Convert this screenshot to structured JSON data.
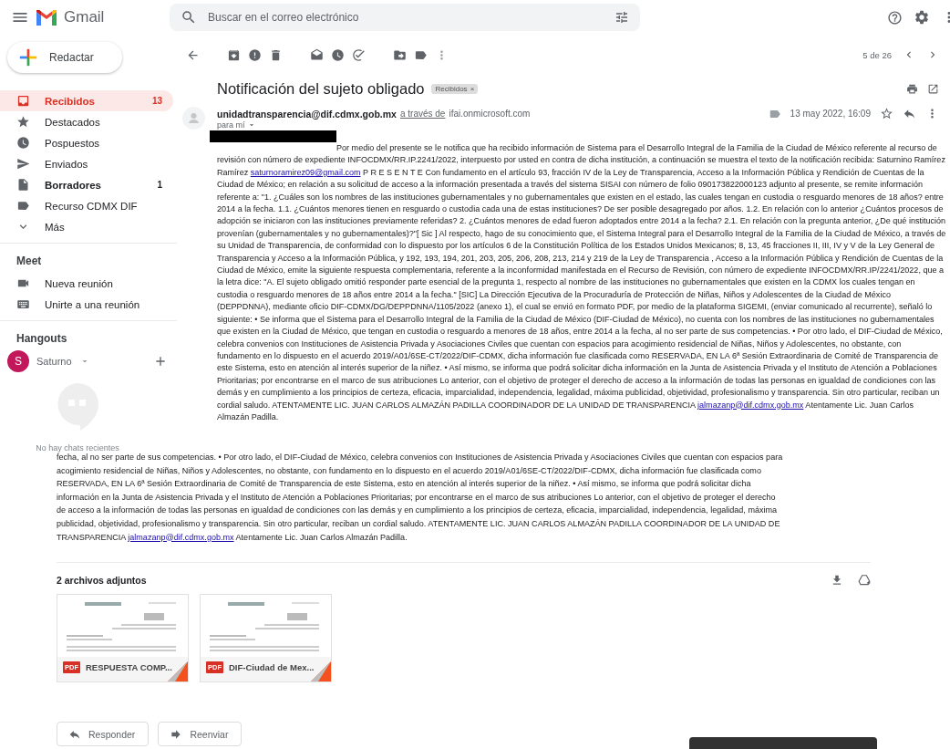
{
  "header": {
    "app_name": "Gmail",
    "search": {
      "placeholder": "Buscar en el correo electrónico"
    }
  },
  "compose": {
    "label": "Redactar"
  },
  "sidebar": {
    "items": [
      {
        "label": "Recibidos",
        "kind": "inbox",
        "count": "13",
        "selected": true,
        "unread": true
      },
      {
        "label": "Destacados",
        "kind": "star",
        "selected": false,
        "unread": false
      },
      {
        "label": "Pospuestos",
        "kind": "clock",
        "selected": false,
        "unread": false
      },
      {
        "label": "Enviados",
        "kind": "send",
        "selected": false,
        "unread": false
      },
      {
        "label": "Borradores",
        "kind": "draft",
        "count": "1",
        "selected": false,
        "unread": true
      },
      {
        "label": "Recurso CDMX DIF",
        "kind": "label",
        "selected": false,
        "unread": false
      },
      {
        "label": "Más",
        "kind": "more",
        "selected": false,
        "unread": false
      }
    ]
  },
  "meet": {
    "title": "Meet",
    "items": [
      {
        "label": "Nueva reunión",
        "kind": "video"
      },
      {
        "label": "Unirte a una reunión",
        "kind": "keyboard"
      }
    ]
  },
  "hangouts": {
    "title": "Hangouts",
    "user": {
      "initial": "S",
      "name": "Saturno"
    },
    "empty_text": "No hay chats recientes"
  },
  "toolbar": {
    "pagination": "5 de 26"
  },
  "message": {
    "subject": "Notificación del sujeto obligado",
    "labels": [
      {
        "text": "Recibidos",
        "remove": "×"
      }
    ],
    "sender": {
      "email": "unidadtransparencia@dif.cdmx.gob.mx",
      "via": "a través de",
      "via_domain": "ifai.onmicrosoft.com"
    },
    "recipient": "para mí",
    "date": "13 may 2022, 16:09",
    "starred": false,
    "body": [
      {
        "kind": "text",
        "text": "Por medio del presente se le notifica que ha recibido información de Sistema para el Desarrollo Integral de la Familia de la Ciudad de México referente al recurso de revisión con número de expediente INFOCDMX/RR.IP.2241/2022, interpuesto por usted en contra de dicha institución, a continuación se muestra el texto de la notificación recibida: Saturnino Ramírez Ramírez "
      },
      {
        "kind": "link",
        "text": "saturnoramirez09@gmail.com"
      },
      {
        "kind": "text",
        "text": " P R E S E N T E Con fundamento en el artículo 93, fracción IV de la Ley de Transparencia, Acceso a la Información Pública y Rendición de Cuentas de la Ciudad de México; en relación a su solicitud de acceso a la información presentada a través del sistema SISAI con número de folio 090173822000123 adjunto al presente, se remite información referente a: \"1. ¿Cuáles son los nombres de las instituciones gubernamentales y no gubernamentales que existen en el estado, las cuales tengan en custodia o resguardo menores de 18 años? entre 2014 a la fecha. 1.1. ¿Cuántos menores tienen en resguardo o custodia cada una de estas instituciones? De ser posible desagregado por años. 1.2. En relación con lo anterior ¿Cuántos procesos de adopción se iniciaron con las instituciones previamente referidas? 2. ¿Cuántos menores de edad fueron adoptados entre 2014 a la fecha? 2.1. En relación con la pregunta anterior, ¿De qué institución provenían (gubernamentales y no gubernamentales)?\"[ Sic ] Al respecto, hago de su conocimiento que, el Sistema Integral para el Desarrollo Integral de la Familia de la Ciudad de México, a través de su Unidad de Transparencia, de conformidad con lo dispuesto por los artículos 6 de la Constitución Política de los Estados Unidos Mexicanos; 8, 13, 45 fracciones II, III, IV y V de la Ley General de Transparencia y Acceso a la Información Pública, y 192, 193, 194, 201, 203, 205, 206, 208, 213, 214 y 219 de la Ley de Transparencia , Acceso a la Información Pública y Rendición de Cuentas de la Ciudad de México, emite la siguiente respuesta complementaria, referente a la inconformidad manifestada en el Recurso de Revisión, con número de expediente INFOCDMX/RR.IP/2241/2022, que a la letra dice: \"A. El sujeto obligado omitió responder parte esencial de la pregunta 1, respecto al nombre de las instituciones no gubernamentales que existen en la CDMX los cuales tengan en custodia o resguardo menores de 18 años entre 2014 a la fecha.\" [SIC] La Dirección Ejecutiva de la Procuraduría de Protección de Niñas, Niños y Adolescentes de la Ciudad de México (DEPPDNNA), mediante oficio DIF-CDMX/DG/DEPPDNNA/1105/2022 (anexo 1), el cual se envió en formato PDF, por medio de la plataforma SIGEMI, (enviar comunicado al recurrente), señaló lo siguiente: • Se informa que el Sistema para el Desarrollo Integral de la Familia de la Ciudad de México (DIF-Ciudad de México), no cuenta con los nombres de las instituciones no gubernamentales que existen en la Ciudad de México, que tengan en custodia o resguardo a menores de 18 años, entre 2014 a la fecha, al no ser parte de sus competencias. • Por otro lado, el DIF-Ciudad de México, celebra convenios con Instituciones de Asistencia Privada y Asociaciones Civiles que cuentan con espacios para acogimiento residencial de Niñas, Niños y Adolescentes, no obstante, con fundamento en lo dispuesto en el acuerdo 2019/A01/6SE-CT/2022/DIF-CDMX, dicha información fue clasificada como RESERVADA, EN LA 6ª Sesión Extraordinaria de Comité de Transparencia de este Sistema, esto en atención al interés superior de la niñez. • Así mismo, se informa que podrá solicitar dicha información en la Junta de Asistencia Privada y el Instituto de Atención a Poblaciones Prioritarias; por encontrarse en el marco de sus atribuciones Lo anterior, con el objetivo de proteger el derecho de acceso a la información de todas las personas en igualdad de condiciones con las demás y en cumplimiento a los principios de certeza, eficacia, imparcialidad, independencia, legalidad, máxima publicidad, objetividad, profesionalismo y transparencia. Sin otro particular, reciban un cordial saludo. ATENTAMENTE LIC. JUAN CARLOS ALMAZÁN PADILLA COORDINADOR DE LA UNIDAD DE TRANSPARENCIA "
      },
      {
        "kind": "link",
        "text": "jalmazanp@dif.cdmx.gob.mx"
      },
      {
        "kind": "text",
        "text": " Atentamente Lic. Juan Carlos Almazán Padilla."
      }
    ],
    "repeated_body": [
      {
        "kind": "text",
        "text": "fecha, al no ser parte de sus competencias. • Por otro lado, el DIF-Ciudad de México, celebra convenios con Instituciones de Asistencia Privada y Asociaciones Civiles que cuentan con espacios para acogimiento residencial de Niñas, Niños y Adolescentes, no obstante, con fundamento en lo dispuesto en el acuerdo 2019/A01/6SE-CT/2022/DIF-CDMX, dicha información fue clasificada como RESERVADA, EN LA 6ª Sesión Extraordinaria de Comité de Transparencia de este Sistema, esto en atención al interés superior de la niñez. • Así mismo, se informa que podrá solicitar dicha información en la Junta de Asistencia Privada y el Instituto de Atención a Poblaciones Prioritarias; por encontrarse en el marco de sus atribuciones Lo anterior, con el objetivo de proteger el derecho de acceso a la información de todas las personas en igualdad de condiciones con las demás y en cumplimiento a los principios de certeza, eficacia, imparcialidad, independencia, legalidad, máxima publicidad, objetividad, profesionalismo y transparencia. Sin otro particular, reciban un cordial saludo. ATENTAMENTE LIC. JUAN CARLOS ALMAZÁN PADILLA COORDINADOR DE LA UNIDAD DE TRANSPARENCIA "
      },
      {
        "kind": "link",
        "text": "jalmazanp@dif.cdmx.gob.mx"
      },
      {
        "kind": "text",
        "text": " Atentamente Lic. Juan Carlos Almazán Padilla."
      }
    ]
  },
  "attachments": {
    "title": "2 archivos adjuntos",
    "files": [
      {
        "badge": "PDF",
        "name": "RESPUESTA COMP..."
      },
      {
        "badge": "PDF",
        "name": "DIF-Ciudad de Mex..."
      }
    ]
  },
  "actions": [
    {
      "kind": "reply",
      "label": "Responder"
    },
    {
      "kind": "forward",
      "label": "Reenviar"
    }
  ]
}
